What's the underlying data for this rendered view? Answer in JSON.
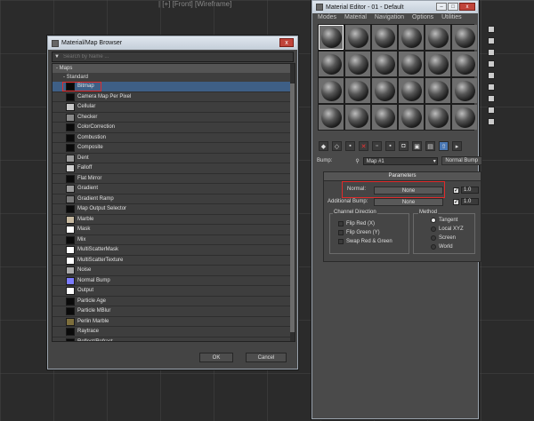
{
  "top_fragment": "| [+] [Front] [Wireframe]",
  "browser": {
    "title": "Material/Map Browser",
    "close_label": "x",
    "search_placeholder": "Search by Name ...",
    "section": "- Maps",
    "subsection": "- Standard",
    "items": [
      {
        "label": "Bitmap",
        "swatch": "#0a0a0a",
        "selected": true
      },
      {
        "label": "Camera Map Per Pixel",
        "swatch": "#0a0a0a"
      },
      {
        "label": "Cellular",
        "swatch": "#c8c8c8"
      },
      {
        "label": "Checker",
        "swatch": "#888888"
      },
      {
        "label": "ColorCorrection",
        "swatch": "#0a0a0a"
      },
      {
        "label": "Combustion",
        "swatch": "#0a0a0a"
      },
      {
        "label": "Composite",
        "swatch": "#0a0a0a"
      },
      {
        "label": "Dent",
        "swatch": "#9a9a9a"
      },
      {
        "label": "Falloff",
        "swatch": "#d0d0d0"
      },
      {
        "label": "Flat Mirror",
        "swatch": "#0a0a0a"
      },
      {
        "label": "Gradient",
        "swatch": "#9a9a9a"
      },
      {
        "label": "Gradient Ramp",
        "swatch": "#7a7a7a"
      },
      {
        "label": "Map Output Selector",
        "swatch": "#0a0a0a"
      },
      {
        "label": "Marble",
        "swatch": "#c7b9a0"
      },
      {
        "label": "Mask",
        "swatch": "#ffffff"
      },
      {
        "label": "Mix",
        "swatch": "#0a0a0a"
      },
      {
        "label": "MultiScatterMask",
        "swatch": "#ffffff"
      },
      {
        "label": "MultiScatterTexture",
        "swatch": "#ffffff"
      },
      {
        "label": "Noise",
        "swatch": "#aaaaaa"
      },
      {
        "label": "Normal Bump",
        "swatch": "#7b7bff"
      },
      {
        "label": "Output",
        "swatch": "#ffffff"
      },
      {
        "label": "Particle Age",
        "swatch": "#0a0a0a"
      },
      {
        "label": "Particle MBlur",
        "swatch": "#0a0a0a"
      },
      {
        "label": "Perlin Marble",
        "swatch": "#7d6e3c"
      },
      {
        "label": "Raytrace",
        "swatch": "#0a0a0a"
      },
      {
        "label": "Reflect/Refract",
        "swatch": "#0a0a0a"
      }
    ],
    "ok_label": "OK",
    "cancel_label": "Cancel"
  },
  "editor": {
    "title": "Material Editor - 01 - Default",
    "menu": [
      "Modes",
      "Material",
      "Navigation",
      "Options",
      "Utilities"
    ],
    "bump_label": "Bump:",
    "map_name": "Map #1",
    "map_type": "Normal Bump",
    "params_header": "Parameters",
    "normal_label": "Normal:",
    "normal_value": "None",
    "normal_amount": "1.0",
    "additional_bump_label": "Additional Bump:",
    "additional_bump_value": "None",
    "additional_amount": "1.0",
    "channel_direction": {
      "title": "Channel Direction",
      "options": [
        "Flip Red (X)",
        "Flip Green (Y)",
        "Swap Red & Green"
      ]
    },
    "method": {
      "title": "Method",
      "options": [
        "Tangent",
        "Local XYZ",
        "Screen",
        "World"
      ],
      "selected": "Tangent"
    }
  },
  "colors": {
    "highlight_red": "#e12b2b",
    "selection_blue": "#3e5f86"
  }
}
